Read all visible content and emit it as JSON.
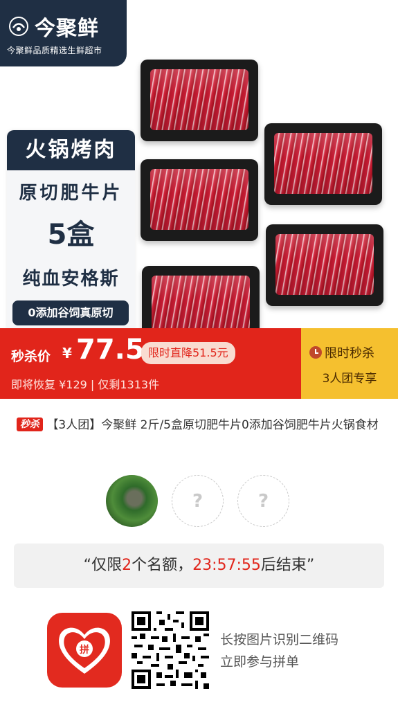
{
  "brand": {
    "name": "今聚鲜",
    "slogan": "今聚鲜品质精选生鲜超市"
  },
  "hero_panel": {
    "title": "火锅烤肉",
    "line1": "原切肥牛片",
    "line2": "5盒",
    "line3": "纯血安格斯",
    "pill": "0添加谷饲真原切"
  },
  "price_bar": {
    "label": "秒杀价",
    "currency": "¥",
    "price": "77.5",
    "drop_badge": "限时直降51.5元",
    "sub": "即将恢复 ¥129 | 仅剩1313件"
  },
  "sell_box": {
    "title": "限时秒杀",
    "subtitle": "3人团专享"
  },
  "product": {
    "tag": "秒杀",
    "title": "【3人团】今聚鲜 2斤/5盒原切肥牛片0添加谷饲肥牛片火锅食材"
  },
  "avatars": {
    "empty_symbol": "?"
  },
  "countdown": {
    "prefix": "“仅限",
    "count": "2",
    "mid": "个名额，",
    "time": "23:57:55",
    "suffix": "后结束”"
  },
  "bottom": {
    "tip_line1": "长按图片识别二维码",
    "tip_line2": "立即参与拼单"
  },
  "colors": {
    "primary_red": "#e1251b",
    "navy": "#1f2f44",
    "gold": "#f5c02f"
  }
}
